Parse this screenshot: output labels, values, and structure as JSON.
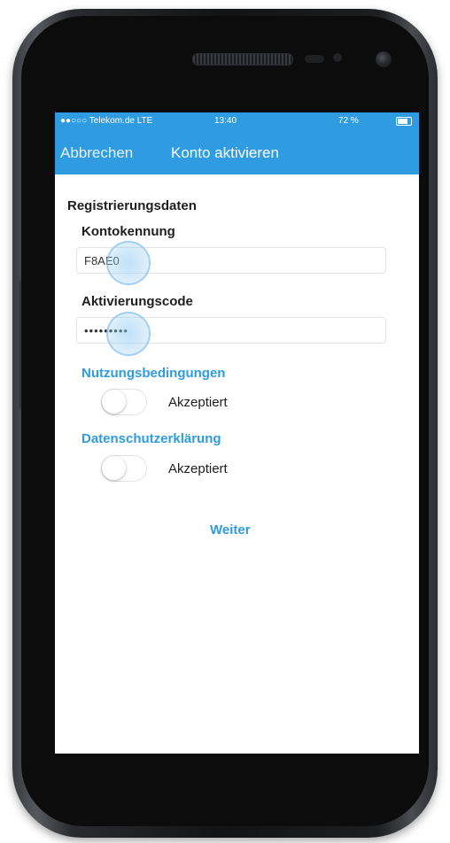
{
  "colors": {
    "accent": "#2f9be0",
    "text": "#1e1e1e",
    "phone_body": "#121314"
  },
  "status_bar": {
    "carrier": "●●○○○ Telekom.de  LTE",
    "time": "13:40",
    "battery": "72 %",
    "battery_icon": "battery-icon"
  },
  "nav": {
    "cancel_label": "Abbrechen",
    "title": "Konto aktivieren"
  },
  "form": {
    "section_title": "Registrierungsdaten",
    "account_label": "Kontokennung",
    "account_value": "F8AE0",
    "code_label": "Aktivierungscode",
    "code_value": "•••••••••"
  },
  "terms": {
    "label": "Nutzungsbedingungen",
    "toggle_text": "Akzeptiert",
    "toggle_on": false
  },
  "privacy": {
    "label": "Datenschutzerklärung",
    "toggle_text": "Akzeptiert",
    "toggle_on": false
  },
  "actions": {
    "next_label": "Weiter"
  }
}
